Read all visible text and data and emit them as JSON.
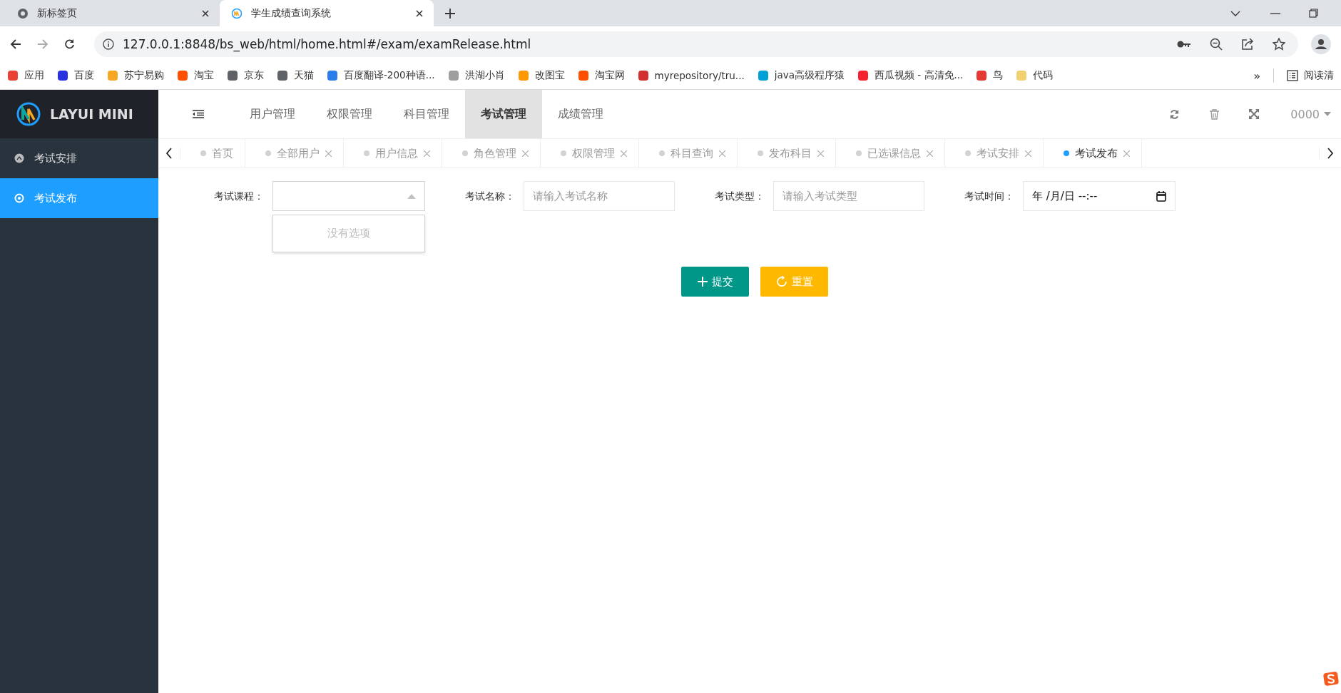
{
  "browser": {
    "tabs": [
      {
        "title": "新标签页",
        "selected": false
      },
      {
        "title": "学生成绩查询系统",
        "selected": true
      }
    ],
    "url": "127.0.0.1:8848/bs_web/html/home.html#/exam/examRelease.html",
    "bookmarks": [
      {
        "label": "应用",
        "color": "#e94235"
      },
      {
        "label": "百度",
        "color": "#2932e1"
      },
      {
        "label": "苏宁易购",
        "color": "#f5a623"
      },
      {
        "label": "淘宝",
        "color": "#ff5000"
      },
      {
        "label": "京东",
        "color": "#5f6368"
      },
      {
        "label": "天猫",
        "color": "#5f6368"
      },
      {
        "label": "百度翻译-200种语...",
        "color": "#2b7de9"
      },
      {
        "label": "洪湖小肖",
        "color": "#9e9e9e"
      },
      {
        "label": "改图宝",
        "color": "#ff9800"
      },
      {
        "label": "淘宝网",
        "color": "#ff5000"
      },
      {
        "label": "myrepository/tru...",
        "color": "#d32f2f"
      },
      {
        "label": "java高级程序猿",
        "color": "#00a1d6"
      },
      {
        "label": "西瓜视频 - 高清免...",
        "color": "#f5222d"
      },
      {
        "label": "鸟",
        "color": "#e53935"
      },
      {
        "label": "代码",
        "color": "#f0d070"
      }
    ],
    "more": "»",
    "reading_list": "阅读清"
  },
  "app": {
    "logo": "LAYUI MINI",
    "sidebar": [
      {
        "label": "考试安排",
        "selected": false
      },
      {
        "label": "考试发布",
        "selected": true
      }
    ],
    "top_menu": [
      {
        "label": "用户管理",
        "selected": false
      },
      {
        "label": "权限管理",
        "selected": false
      },
      {
        "label": "科目管理",
        "selected": false
      },
      {
        "label": "考试管理",
        "selected": true
      },
      {
        "label": "成绩管理",
        "selected": false
      }
    ],
    "user": "0000",
    "page_tabs": [
      {
        "label": "首页",
        "closable": false,
        "selected": false
      },
      {
        "label": "全部用户",
        "closable": true,
        "selected": false
      },
      {
        "label": "用户信息",
        "closable": true,
        "selected": false
      },
      {
        "label": "角色管理",
        "closable": true,
        "selected": false
      },
      {
        "label": "权限管理",
        "closable": true,
        "selected": false
      },
      {
        "label": "科目查询",
        "closable": true,
        "selected": false
      },
      {
        "label": "发布科目",
        "closable": true,
        "selected": false
      },
      {
        "label": "已选课信息",
        "closable": true,
        "selected": false
      },
      {
        "label": "考试安排",
        "closable": true,
        "selected": false
      },
      {
        "label": "考试发布",
        "closable": true,
        "selected": true
      }
    ],
    "form": [
      {
        "kind": "select",
        "label": "考试课程：",
        "expanded": true,
        "empty_text": "没有选项"
      },
      {
        "kind": "text",
        "label": "考试名称：",
        "placeholder": "请输入考试名称"
      },
      {
        "kind": "text",
        "label": "考试类型：",
        "placeholder": "请输入考试类型"
      },
      {
        "kind": "datetime",
        "label": "考试时间：",
        "value": "年 /月/日 --:--"
      }
    ],
    "buttons": [
      {
        "kind": "submit",
        "label": "提交"
      },
      {
        "kind": "reset",
        "label": "重置"
      }
    ]
  }
}
